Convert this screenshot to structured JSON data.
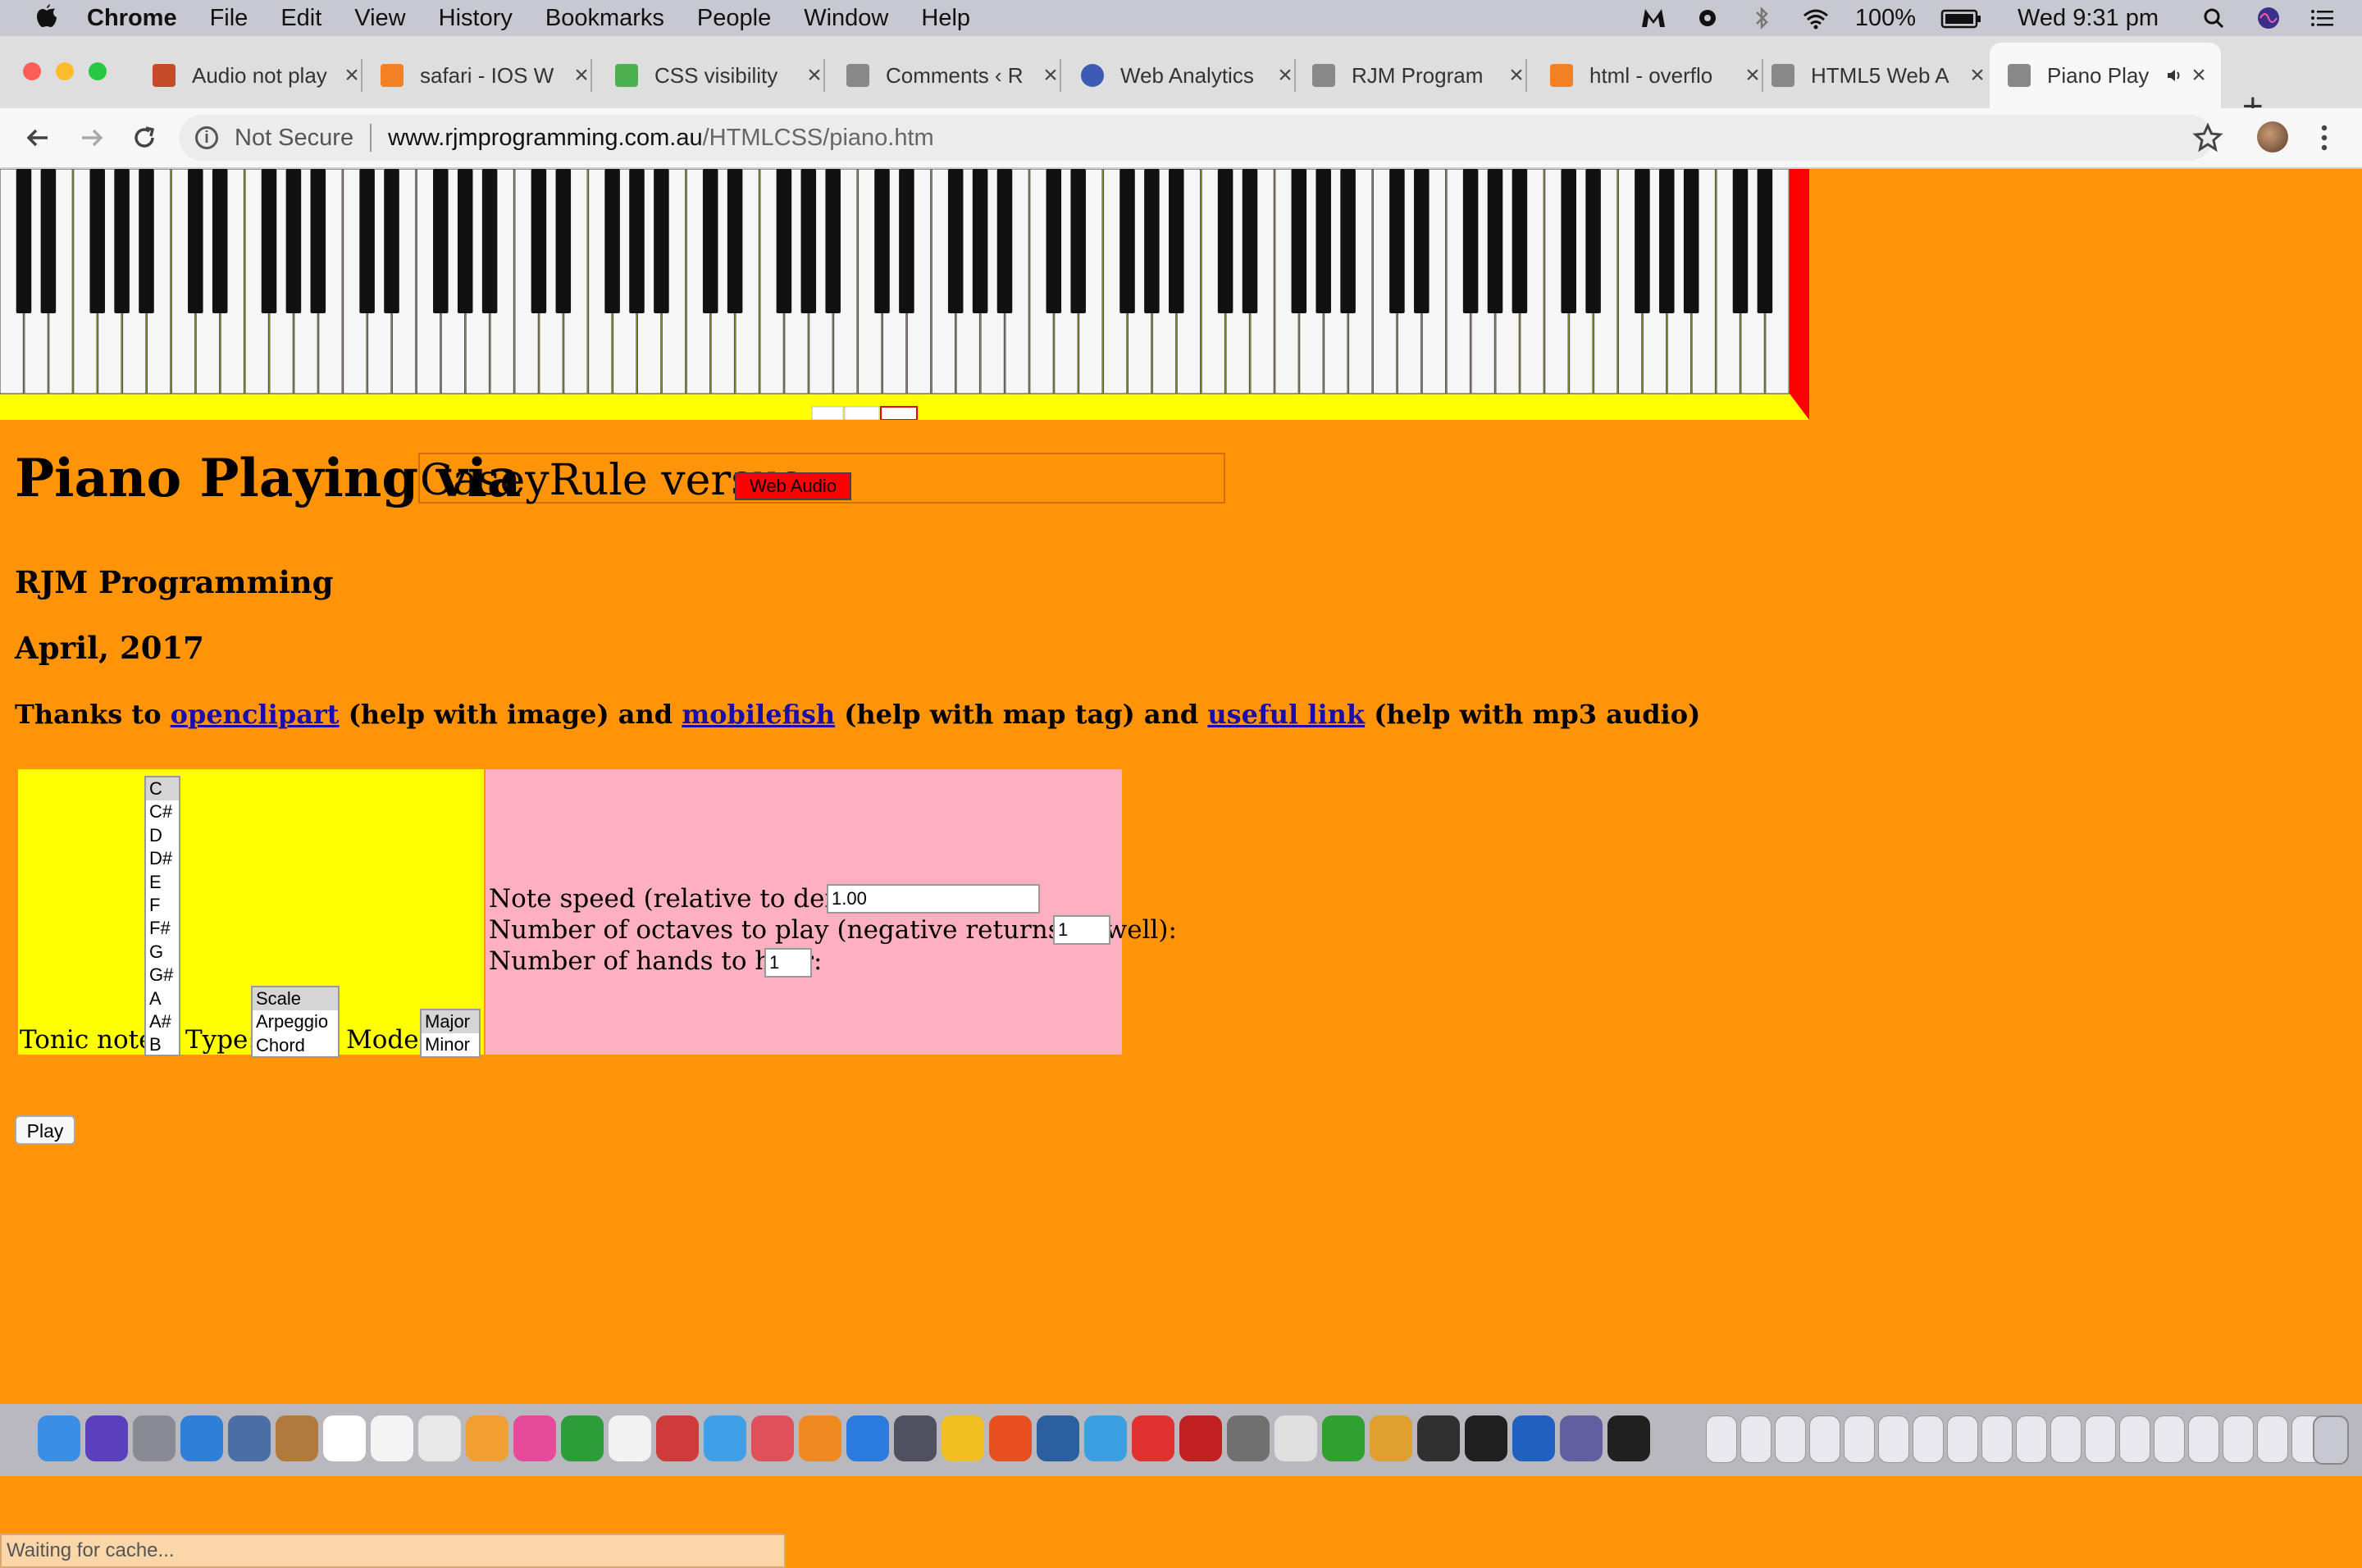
{
  "menubar": {
    "app": "Chrome",
    "items": [
      "File",
      "Edit",
      "View",
      "History",
      "Bookmarks",
      "People",
      "Window",
      "Help"
    ],
    "battery": "100%",
    "clock": "Wed 9:31 pm"
  },
  "tabs": [
    {
      "title": "Audio not play",
      "color": "#c44a2a"
    },
    {
      "title": "safari - IOS W",
      "color": "#f48024"
    },
    {
      "title": "CSS visibility",
      "color": "#4caf50"
    },
    {
      "title": "Comments ‹ R",
      "color": "#888888"
    },
    {
      "title": "Web Analytics",
      "color": "#3b5bb5"
    },
    {
      "title": "RJM Program",
      "color": "#888888"
    },
    {
      "title": "html - overflo",
      "color": "#f48024"
    },
    {
      "title": "HTML5 Web A",
      "color": "#888888"
    },
    {
      "title": "Piano Play",
      "color": "#888888"
    }
  ],
  "address": {
    "security": "Not Secure",
    "host": "www.rjmprogramming.com.au",
    "path": "/HTMLCSS/piano.htm"
  },
  "page": {
    "headline": "Piano Playing via",
    "headline_box_text": "CaseyRule versus",
    "web_audio_button": "Web Audio",
    "author": "RJM Programming",
    "date": "April, 2017",
    "thanks": {
      "prefix": "Thanks to",
      "link1": "openclipart",
      "mid1": "(help with image) and",
      "link2": "mobilefish",
      "mid2": "(help with map tag) and",
      "link3": "useful link",
      "suffix": "(help with mp3 audio)"
    },
    "tonic_label": "Tonic note:",
    "tonic_options": [
      "C",
      "C#",
      "D",
      "D#",
      "E",
      "F",
      "F#",
      "G",
      "G#",
      "A",
      "A#",
      "B"
    ],
    "type_label": "Type:",
    "type_options": [
      "Scale",
      "Arpeggio",
      "Chord"
    ],
    "mode_label": "Mode:",
    "mode_options": [
      "Major",
      "Minor"
    ],
    "speed_label": "Note speed (relative to default):",
    "speed_value": "1.00",
    "octaves_label": "Number of octaves to play (negative returns as well):",
    "octaves_value": "1",
    "hands_label": "Number of hands to hear:",
    "hands_value": "1",
    "play_button": "Play"
  },
  "status": "Waiting for cache...",
  "colors": {
    "page_bg": "#ff9409",
    "yellow": "#ffff00",
    "pink": "#ffb0c0",
    "red_button": "#ff0000",
    "link": "#1a0dab"
  }
}
